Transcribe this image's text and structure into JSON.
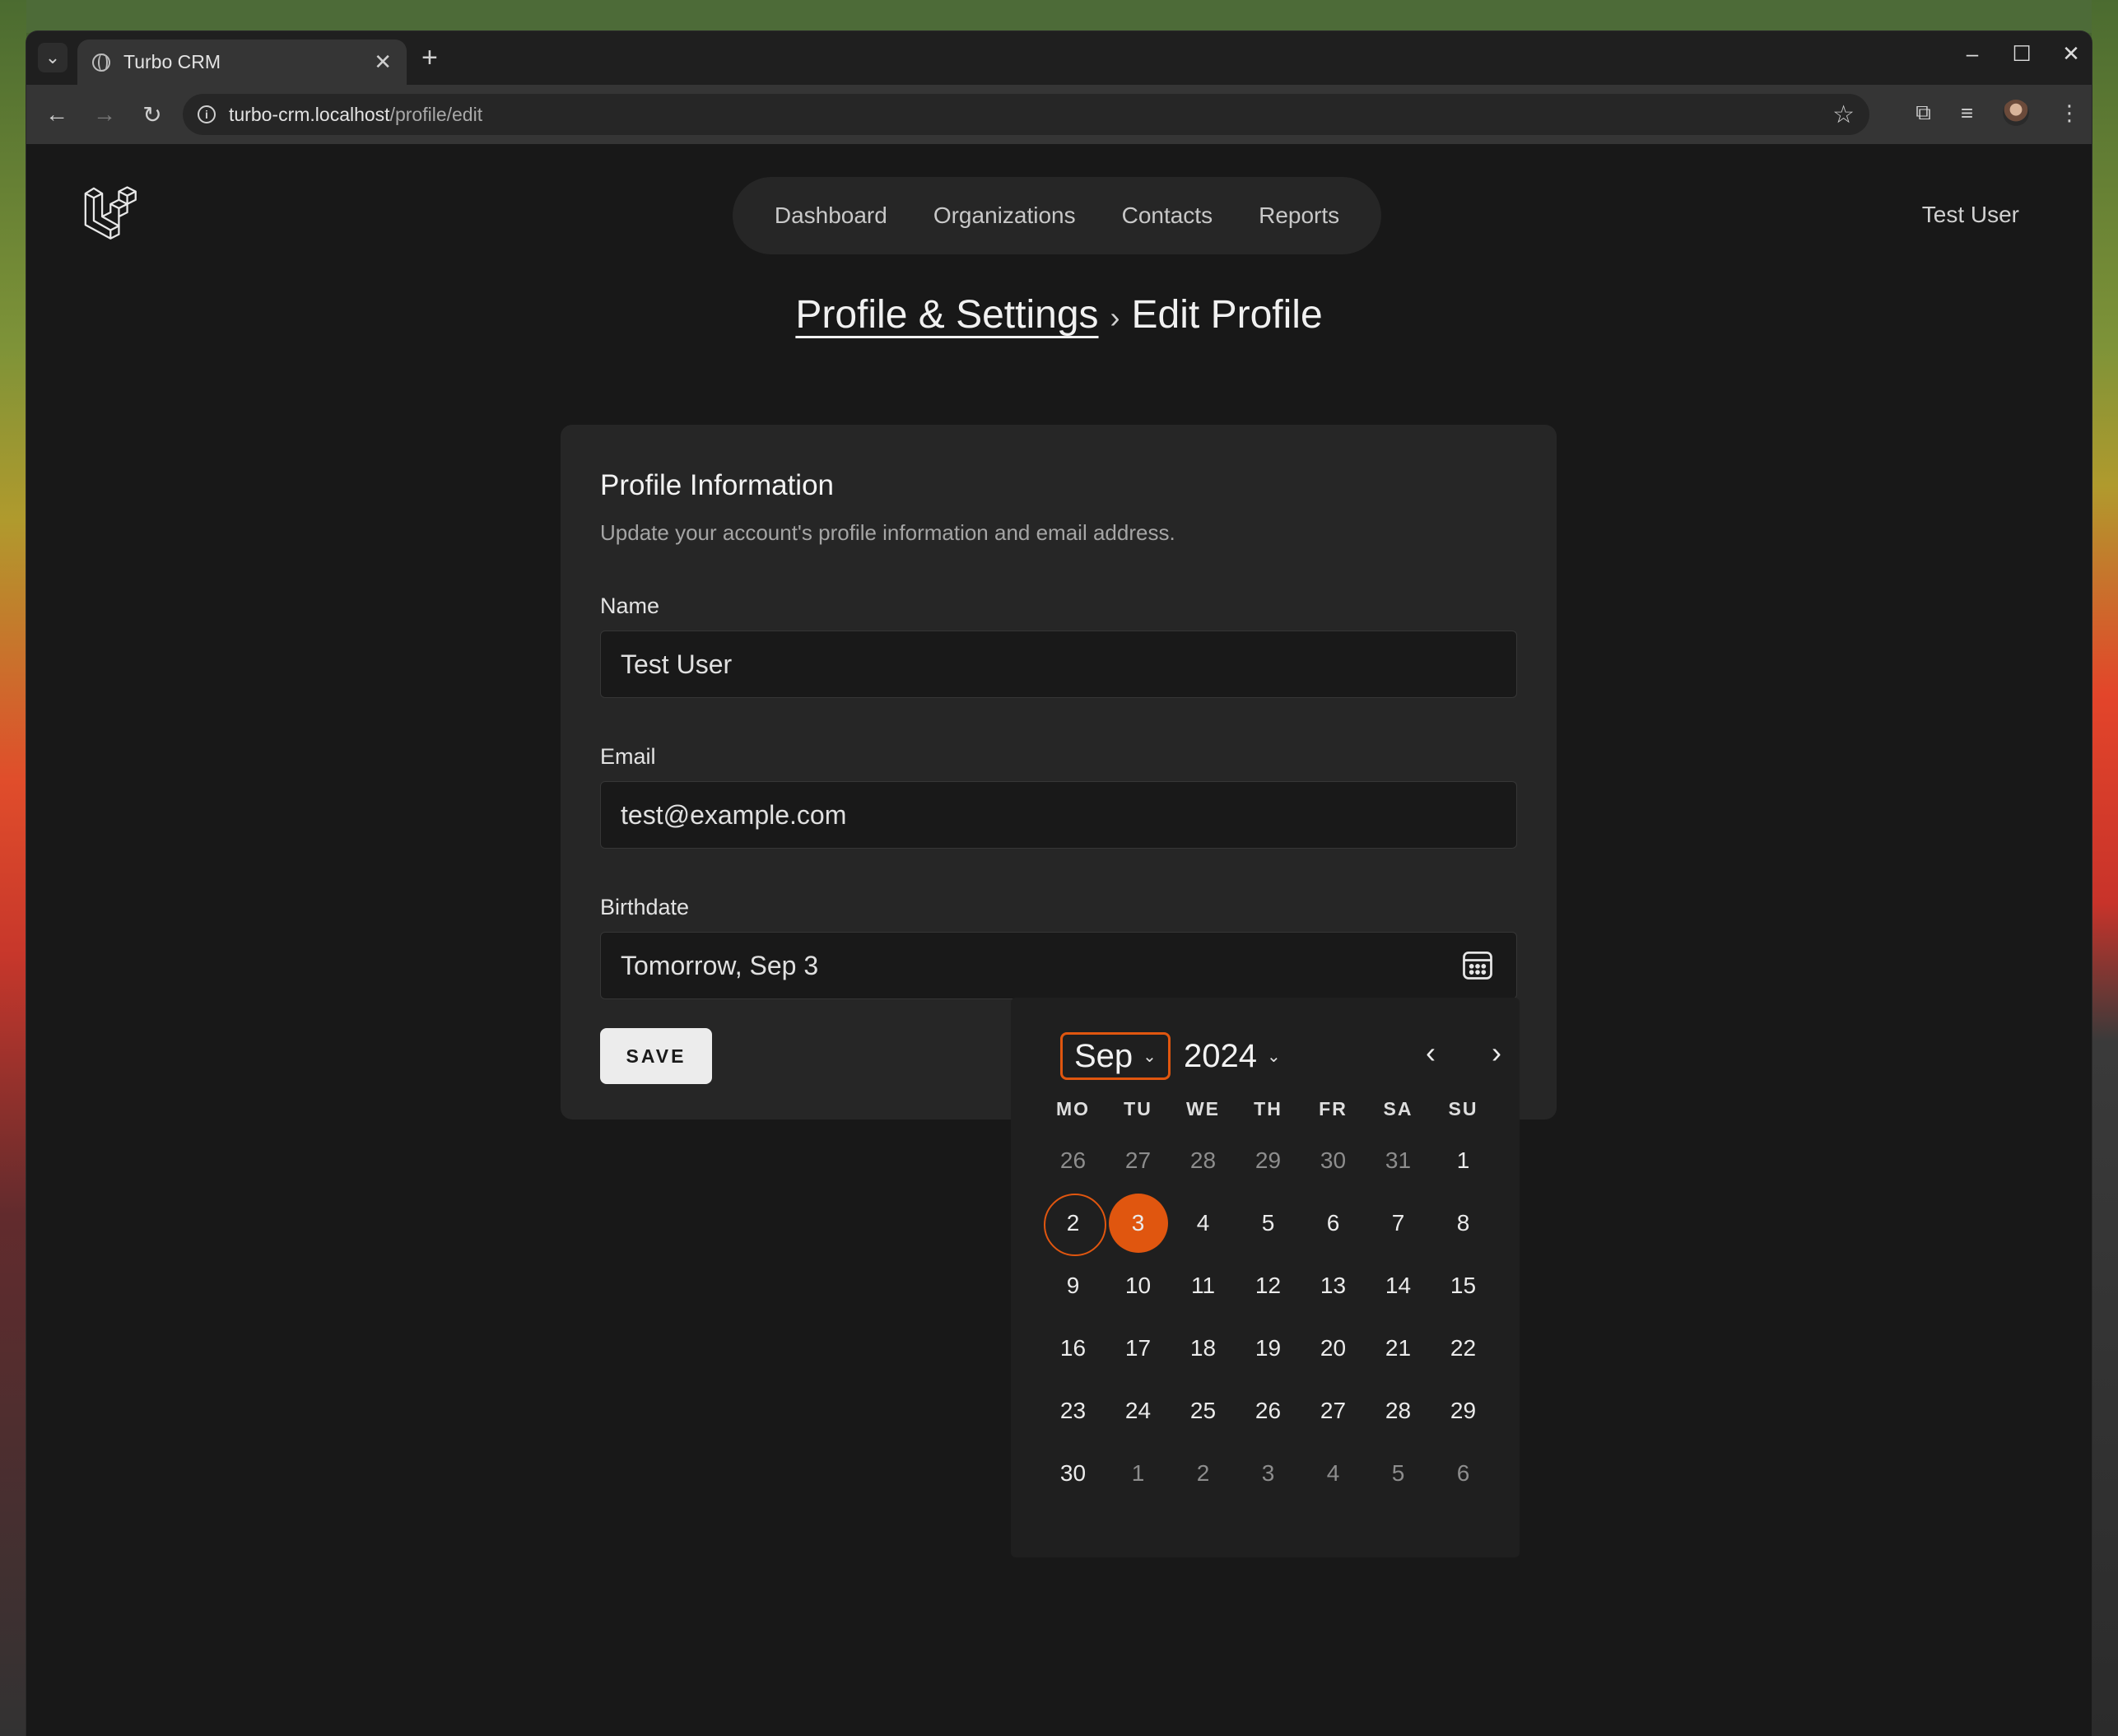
{
  "browser": {
    "tab_title": "Turbo CRM",
    "url_host": "turbo-crm.localhost",
    "url_path": "/profile/edit"
  },
  "nav": {
    "items": [
      {
        "label": "Dashboard"
      },
      {
        "label": "Organizations"
      },
      {
        "label": "Contacts"
      },
      {
        "label": "Reports"
      }
    ],
    "user": "Test User"
  },
  "breadcrumb": {
    "parent": "Profile & Settings",
    "current": "Edit Profile"
  },
  "profile": {
    "title": "Profile Information",
    "description": "Update your account's profile information and email address.",
    "name_label": "Name",
    "name_value": "Test User",
    "email_label": "Email",
    "email_value": "test@example.com",
    "birthdate_label": "Birthdate",
    "birthdate_value": "Tomorrow, Sep 3",
    "save_label": "SAVE"
  },
  "calendar": {
    "month": "Sep",
    "year": "2024",
    "weekdays": [
      "MO",
      "TU",
      "WE",
      "TH",
      "FR",
      "SA",
      "SU"
    ],
    "weeks": [
      [
        "26",
        "27",
        "28",
        "29",
        "30",
        "31",
        "1"
      ],
      [
        "2",
        "3",
        "4",
        "5",
        "6",
        "7",
        "8"
      ],
      [
        "9",
        "10",
        "11",
        "12",
        "13",
        "14",
        "15"
      ],
      [
        "16",
        "17",
        "18",
        "19",
        "20",
        "21",
        "22"
      ],
      [
        "23",
        "24",
        "25",
        "26",
        "27",
        "28",
        "29"
      ],
      [
        "30",
        "1",
        "2",
        "3",
        "4",
        "5",
        "6"
      ]
    ],
    "today": "2",
    "selected": "3",
    "accent_color": "#e0560f"
  }
}
